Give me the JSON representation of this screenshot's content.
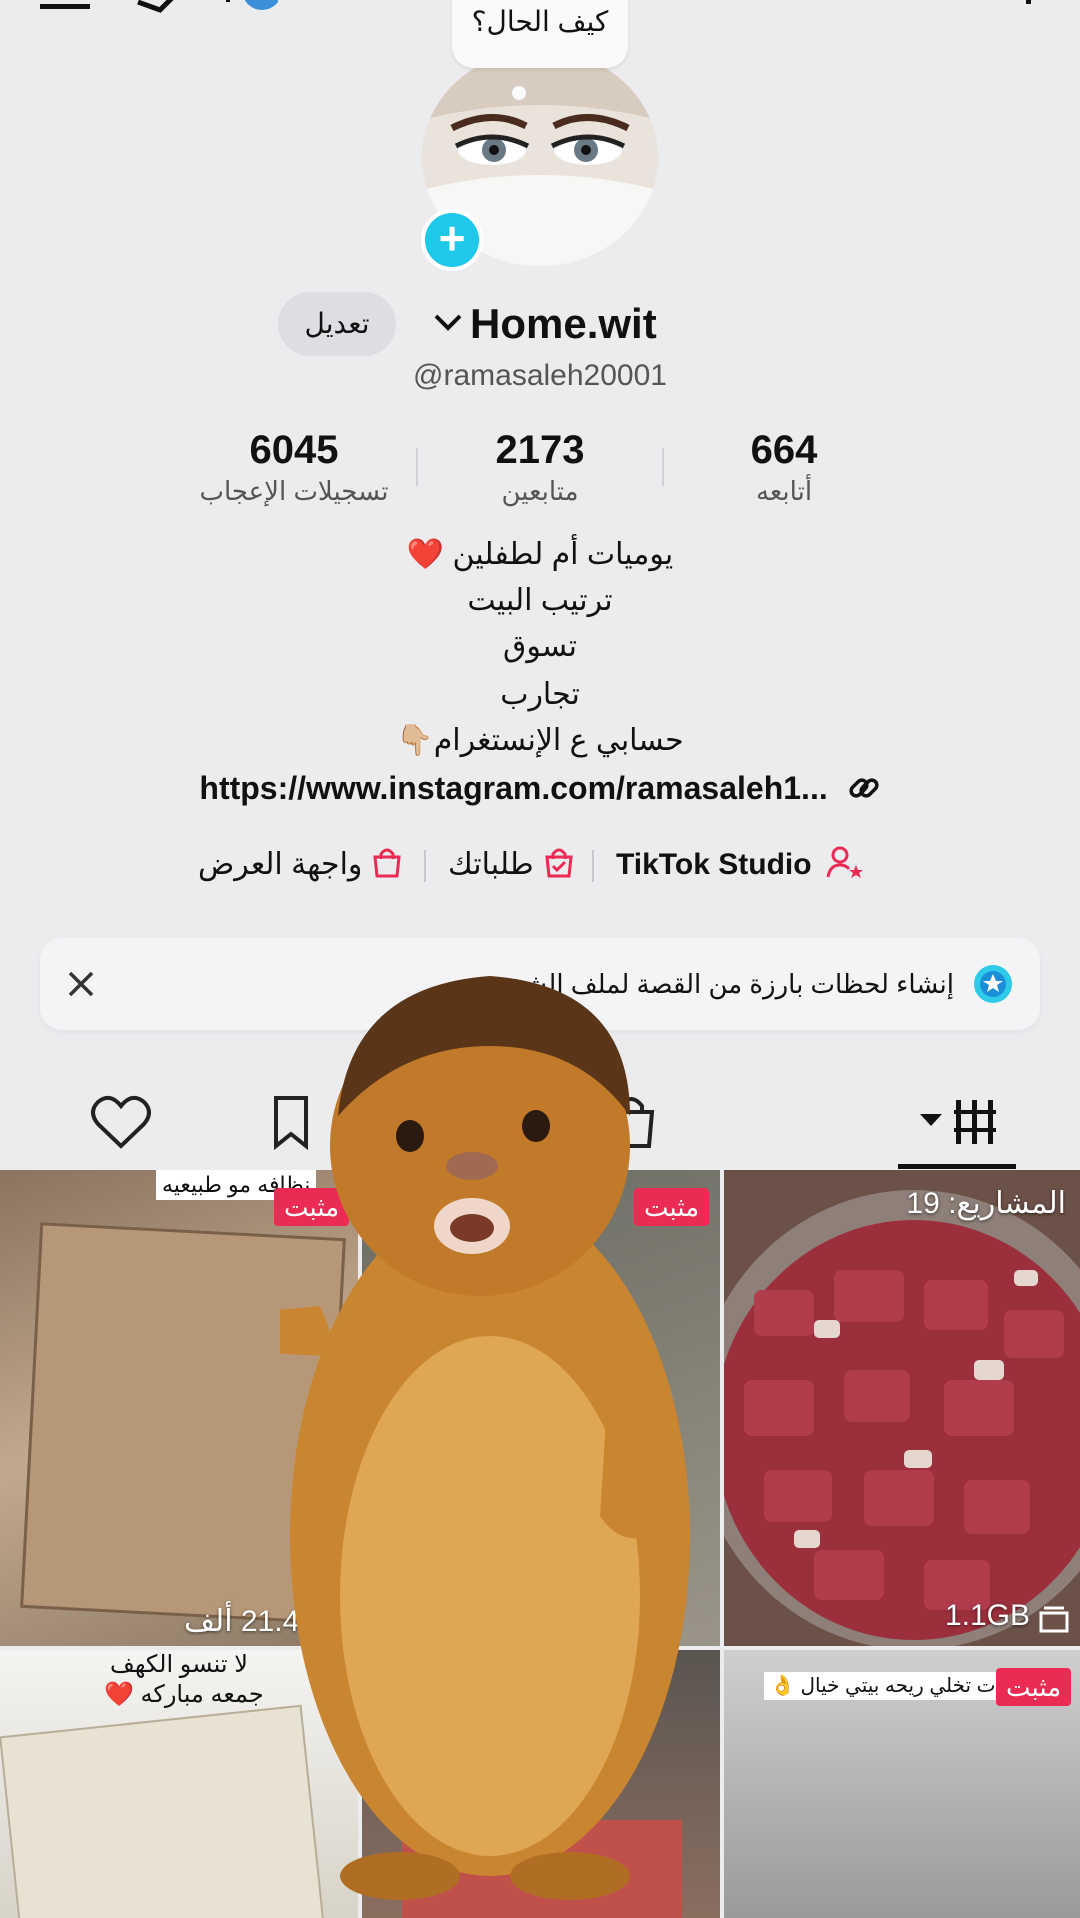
{
  "top": {
    "status_bubble": "كيف الحال؟"
  },
  "profile": {
    "edit_label": "تعديل",
    "display_name": "Home.wit",
    "handle": "@ramasaleh20001"
  },
  "stats": [
    {
      "value": "6045",
      "label": "تسجيلات الإعجاب"
    },
    {
      "value": "2173",
      "label": "متابعين"
    },
    {
      "value": "664",
      "label": "أتابعه"
    }
  ],
  "bio": {
    "line1": "يوميات أم لطفلين ❤️",
    "line2": "ترتيب البيت",
    "line3": "تسوق",
    "line4": "تجارب",
    "line5": "حسابي ع الإنستغرام👇🏼",
    "link": "https://www.instagram.com/ramasaleh1..."
  },
  "quick_links": {
    "showcase": "واجهة العرض",
    "orders": "طلباتك",
    "studio": "TikTok Studio"
  },
  "banner": {
    "text": "إنشاء لحظات بارزة من القصة لملف الشخصي"
  },
  "tiles": {
    "t1_caption": "نظافه مو طبيعيه",
    "t1_pinned": "مثبت",
    "t1_views": "21.4 ألف",
    "t2_pinned": "مثبت",
    "t3_caption": "المشاريع: 19",
    "t3_size": "1.1GB",
    "t4_caption1": "لا تنسو الكهف",
    "t4_caption2": "جمعه مباركه ❤️",
    "t6_caption": "منتجات تخلي ريحه بيتي خيال 👌",
    "t6_pinned": "مثبت"
  },
  "colors": {
    "accent_cyan": "#1fc8e8",
    "pinned_red": "#ea2c54",
    "background": "#ececef"
  }
}
